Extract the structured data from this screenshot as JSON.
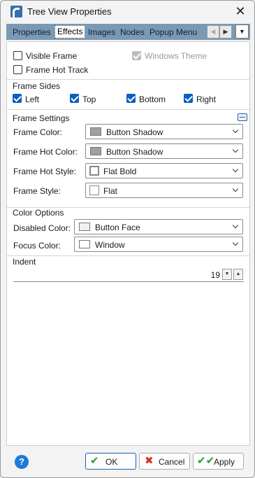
{
  "window": {
    "title": "Tree View Properties"
  },
  "tabs": [
    {
      "label": "Properties",
      "active": false
    },
    {
      "label": "Effects",
      "active": true
    },
    {
      "label": "Images",
      "active": false
    },
    {
      "label": "Nodes",
      "active": false
    },
    {
      "label": "Popup Menu",
      "active": false
    }
  ],
  "options": {
    "visible_frame": {
      "label": "Visible Frame",
      "checked": false
    },
    "frame_hot_track": {
      "label": "Frame Hot Track",
      "checked": false
    },
    "windows_theme": {
      "label": "Windows Theme",
      "checked": true,
      "disabled": true
    }
  },
  "frame_sides": {
    "title": "Frame Sides",
    "left": {
      "label": "Left",
      "checked": true
    },
    "top": {
      "label": "Top",
      "checked": true
    },
    "bottom": {
      "label": "Bottom",
      "checked": true
    },
    "right": {
      "label": "Right",
      "checked": true
    }
  },
  "frame_settings": {
    "title": "Frame Settings",
    "frame_color": {
      "label": "Frame Color:",
      "value": "Button Shadow",
      "swatch": "#a0a0a0"
    },
    "frame_hot_color": {
      "label": "Frame Hot Color:",
      "value": "Button Shadow",
      "swatch": "#a0a0a0"
    },
    "frame_hot_style": {
      "label": "Frame Hot Style:",
      "value": "Flat Bold",
      "swatch": "#ffffff"
    },
    "frame_style": {
      "label": "Frame Style:",
      "value": "Flat",
      "swatch": "#ffffff"
    }
  },
  "color_options": {
    "title": "Color Options",
    "disabled_color": {
      "label": "Disabled Color:",
      "value": "Button Face",
      "swatch": "#f0f0f0"
    },
    "focus_color": {
      "label": "Focus Color:",
      "value": "Window",
      "swatch": "#ffffff"
    }
  },
  "indent": {
    "title": "Indent",
    "value": "19"
  },
  "footer": {
    "ok_label": "OK",
    "cancel_label": "Cancel",
    "apply_label": "Apply"
  }
}
